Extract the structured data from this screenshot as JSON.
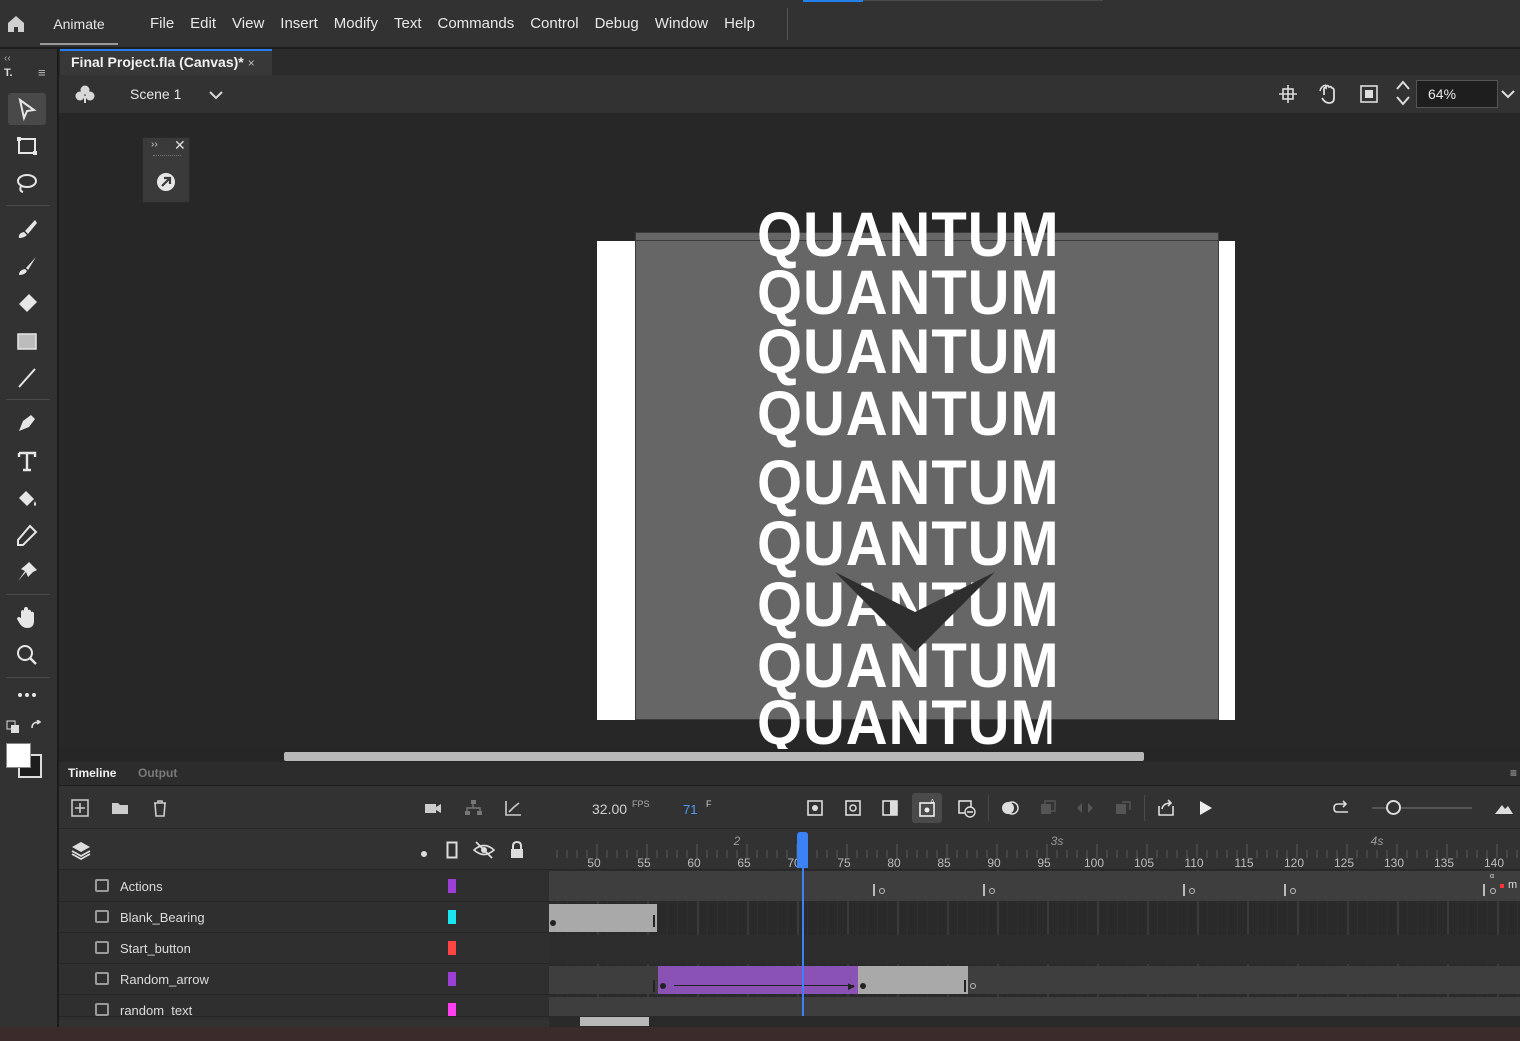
{
  "app": {
    "name": "Animate",
    "home_icon": "home-icon"
  },
  "menu": [
    "File",
    "Edit",
    "View",
    "Insert",
    "Modify",
    "Text",
    "Commands",
    "Control",
    "Debug",
    "Window",
    "Help"
  ],
  "document": {
    "tab_title": "Final Project.fla (Canvas)*",
    "close_glyph": "×"
  },
  "editbar": {
    "scene": "Scene 1",
    "zoom": "64%"
  },
  "stage": {
    "words": [
      "QUANTUM",
      "QUANTUM",
      "QUANTUM",
      "QUANTUM",
      "QUANTUM",
      "QUANTUM",
      "QUANTUM",
      "QUANTUM",
      "QUANTUM"
    ],
    "colors": {
      "stage_white": "#ffffff",
      "stage_gray": "#666666",
      "arrow": "#2e2e2e"
    }
  },
  "timeline": {
    "tabs": {
      "timeline": "Timeline",
      "output": "Output"
    },
    "fps": "32.00",
    "fps_unit": "FPS",
    "current_frame": "71",
    "frame_unit": "F",
    "ruler_ticks": [
      "50",
      "55",
      "60",
      "65",
      "70",
      "75",
      "80",
      "85",
      "90",
      "95",
      "100",
      "105",
      "110",
      "115",
      "120",
      "125",
      "130",
      "135",
      "140"
    ],
    "ruler_seconds": [
      "2",
      "3s",
      "4s"
    ],
    "layers": [
      {
        "name": "Actions",
        "color": "#9b3fd6"
      },
      {
        "name": "Blank_Bearing",
        "color": "#19e6ee"
      },
      {
        "name": "Start_button",
        "color": "#ff4444"
      },
      {
        "name": "Random_arrow",
        "color": "#9b3fd6"
      },
      {
        "name": "random_text",
        "color": "#ff3ef0"
      }
    ],
    "tween_color": "#8a52b4"
  }
}
